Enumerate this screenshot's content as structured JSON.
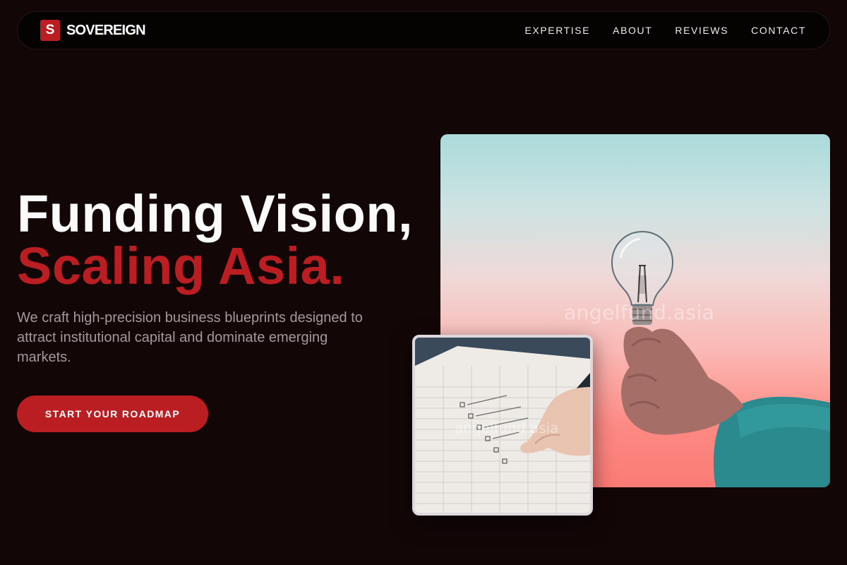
{
  "brand": {
    "mark": "S",
    "name": "SOVEREIGN"
  },
  "nav": {
    "links": [
      "EXPERTISE",
      "ABOUT",
      "REVIEWS",
      "CONTACT"
    ]
  },
  "hero": {
    "headline_line1": "Funding Vision,",
    "headline_line2": "Scaling Asia.",
    "subtitle": "We craft high-precision business blueprints designed to attract institutional capital and dominate emerging markets.",
    "cta_label": "START YOUR ROADMAP"
  },
  "images": {
    "main_watermark": "angelfund.asia",
    "small_watermark": "angelfund.asia"
  },
  "colors": {
    "background": "#130607",
    "accent": "#bb1e22",
    "nav_bg": "#050202",
    "subtitle_text": "#a29a9c"
  }
}
